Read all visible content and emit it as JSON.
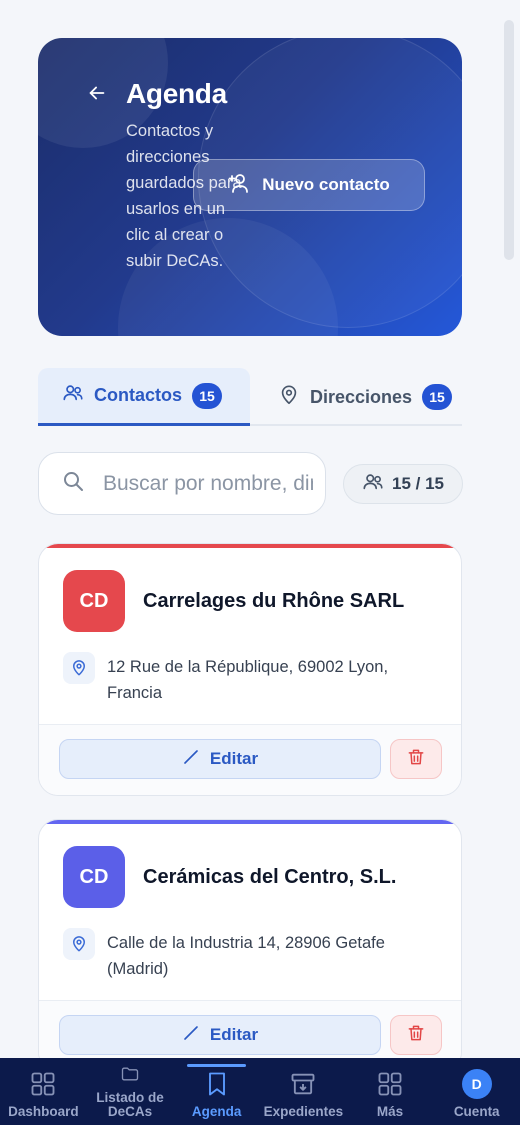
{
  "hero": {
    "title": "Agenda",
    "description": "Contactos y direcciones guardados para usarlos en un clic al crear o subir DeCAs.",
    "new_contact_label": "Nuevo contacto"
  },
  "tabs": [
    {
      "label": "Contactos",
      "count": "15",
      "active": true
    },
    {
      "label": "Direcciones",
      "count": "15",
      "active": false
    }
  ],
  "search": {
    "placeholder": "Buscar por nombre, dirección...",
    "value": ""
  },
  "count_pill": "15 / 15",
  "cards": [
    {
      "initials": "CD",
      "name": "Carrelages du Rhône SARL",
      "address": "12 Rue de la République, 69002 Lyon, Francia",
      "avatar_color": "#e5484d",
      "accent_color": "#e5484d",
      "edit_label": "Editar"
    },
    {
      "initials": "CD",
      "name": "Cerámicas del Centro, S.L.",
      "address": "Calle de la Industria 14, 28906 Getafe (Madrid)",
      "avatar_color": "#5b5fe8",
      "accent_color": "#6366f1",
      "edit_label": "Editar"
    }
  ],
  "nav": [
    {
      "label": "Dashboard",
      "icon": "dashboard-icon",
      "active": false
    },
    {
      "label": "Listado de DeCAs",
      "icon": "folder-icon",
      "active": false
    },
    {
      "label": "Agenda",
      "icon": "bookmark-icon",
      "active": true
    },
    {
      "label": "Expedientes",
      "icon": "archive-icon",
      "active": false
    },
    {
      "label": "Más",
      "icon": "grid-icon",
      "active": false
    },
    {
      "label": "Cuenta",
      "icon": "account-avatar",
      "avatar_initial": "D",
      "active": false
    }
  ],
  "colors": {
    "primary": "#2b59c3",
    "nav_bg": "#0c1a4b",
    "danger": "#e24646"
  }
}
